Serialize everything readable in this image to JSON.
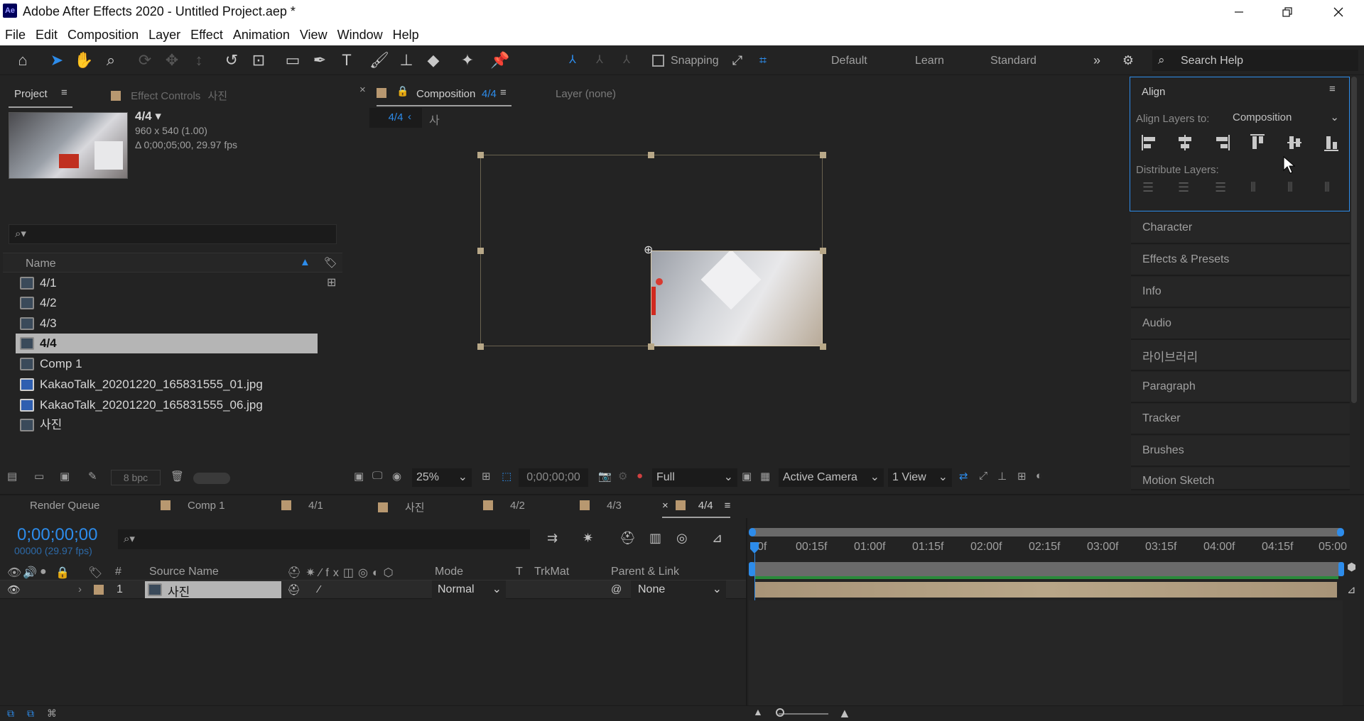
{
  "window": {
    "title": "Adobe After Effects 2020 - Untitled Project.aep *",
    "app_badge": "Ae"
  },
  "menu": [
    "File",
    "Edit",
    "Composition",
    "Layer",
    "Effect",
    "Animation",
    "View",
    "Window",
    "Help"
  ],
  "toolbar": {
    "snapping_label": "Snapping",
    "workspaces": [
      "Default",
      "Learn",
      "Standard"
    ],
    "search_placeholder": "Search Help"
  },
  "project_panel": {
    "tab_label": "Project",
    "effect_controls_label": "Effect Controls",
    "effect_controls_target": "사진",
    "selected_name": "4/4",
    "selected_dims": "960 x 540 (1.00)",
    "selected_duration": "Δ 0;00;05;00, 29.97 fps",
    "column_name": "Name",
    "items": [
      {
        "name": "4/1",
        "type": "comp"
      },
      {
        "name": "4/2",
        "type": "comp"
      },
      {
        "name": "4/3",
        "type": "comp"
      },
      {
        "name": "4/4",
        "type": "comp",
        "selected": true
      },
      {
        "name": "Comp 1",
        "type": "comp"
      },
      {
        "name": "KakaoTalk_20201220_165831555_01.jpg",
        "type": "image"
      },
      {
        "name": "KakaoTalk_20201220_165831555_06.jpg",
        "type": "image"
      },
      {
        "name": "사진",
        "type": "comp"
      }
    ],
    "bpc_label": "8 bpc"
  },
  "comp_panel": {
    "tab_label": "Composition",
    "tab_comp": "4/4",
    "layer_tab": "Layer (none)",
    "breadcrumb_current": "4/4",
    "breadcrumb_next": "사진",
    "zoom": "25%",
    "timecode": "0;00;00;00",
    "resolution": "Full",
    "camera": "Active Camera",
    "views": "1 View"
  },
  "align_panel": {
    "title": "Align",
    "align_to_label": "Align Layers to:",
    "align_to_value": "Composition",
    "distribute_label": "Distribute Layers:"
  },
  "right_panels": [
    "Character",
    "Effects & Presets",
    "Info",
    "Audio",
    "라이브러리",
    "Paragraph",
    "Tracker",
    "Brushes",
    "Motion Sketch"
  ],
  "bottom_tabs": [
    {
      "label": "Render Queue",
      "color": null
    },
    {
      "label": "Comp 1",
      "color": "#b89870"
    },
    {
      "label": "4/1",
      "color": "#b89870"
    },
    {
      "label": "사진",
      "color": "#b89870"
    },
    {
      "label": "4/2",
      "color": "#b89870"
    },
    {
      "label": "4/3",
      "color": "#b89870"
    },
    {
      "label": "4/4",
      "color": "#b89870",
      "active": true
    }
  ],
  "timeline": {
    "current_time": "0;00;00;00",
    "frame_info": "00000 (29.97 fps)",
    "ruler": [
      "0f",
      "00:15f",
      "01:00f",
      "01:15f",
      "02:00f",
      "02:15f",
      "03:00f",
      "03:15f",
      "04:00f",
      "04:15f",
      "05:00"
    ],
    "columns": {
      "num": "#",
      "source": "Source Name",
      "mode": "Mode",
      "t": "T",
      "trkmat": "TrkMat",
      "parent": "Parent & Link"
    },
    "layer": {
      "index": "1",
      "name": "사진",
      "mode": "Normal",
      "parent": "None"
    }
  },
  "colors": {
    "accent": "#2d8ceb",
    "label_tan": "#b89870",
    "bg": "#232323"
  }
}
